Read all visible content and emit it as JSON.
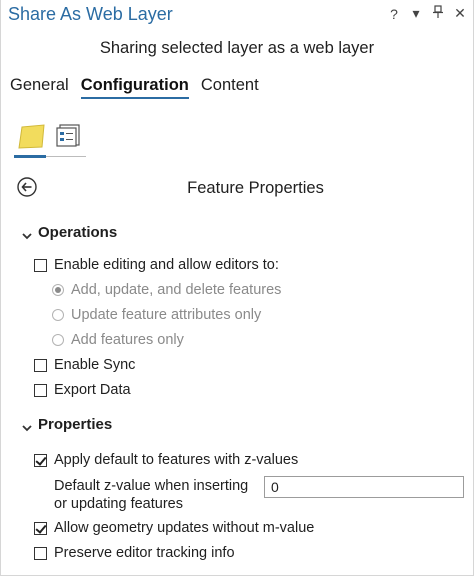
{
  "window": {
    "title": "Share As Web Layer",
    "icons": [
      "help-icon",
      "dropdown-icon",
      "pin-icon",
      "close-icon"
    ],
    "help_glyph": "?",
    "dropdown_glyph": "▾",
    "close_glyph": "✕"
  },
  "subtitle": "Sharing selected layer as a web layer",
  "tabs": [
    {
      "label": "General",
      "active": false
    },
    {
      "label": "Configuration",
      "active": true
    },
    {
      "label": "Content",
      "active": false
    }
  ],
  "subtabs": [
    "feature-layer-icon",
    "configure-pane-icon"
  ],
  "panel": {
    "title": "Feature Properties",
    "back_icon": "back-arrow-icon"
  },
  "operations": {
    "heading": "Operations",
    "enable_editing": {
      "label": "Enable editing and allow editors to:",
      "checked": false
    },
    "edit_options": [
      {
        "label": "Add, update, and delete features",
        "selected": true
      },
      {
        "label": "Update feature attributes only",
        "selected": false
      },
      {
        "label": "Add features only",
        "selected": false
      }
    ],
    "enable_sync": {
      "label": "Enable Sync",
      "checked": false
    },
    "export_data": {
      "label": "Export Data",
      "checked": false
    }
  },
  "properties": {
    "heading": "Properties",
    "apply_default_z": {
      "label": "Apply default to features with z-values",
      "checked": true
    },
    "default_z_label": "Default z-value when inserting or updating features",
    "default_z_value": "0",
    "allow_geometry_updates": {
      "label": "Allow geometry updates without m-value",
      "checked": true
    },
    "preserve_tracking": {
      "label": "Preserve editor tracking info",
      "checked": false
    }
  },
  "colors": {
    "accent": "#2b6ca3",
    "feature_icon_fill": "#f2dc5d",
    "disabled_text": "#8a8a8a"
  }
}
